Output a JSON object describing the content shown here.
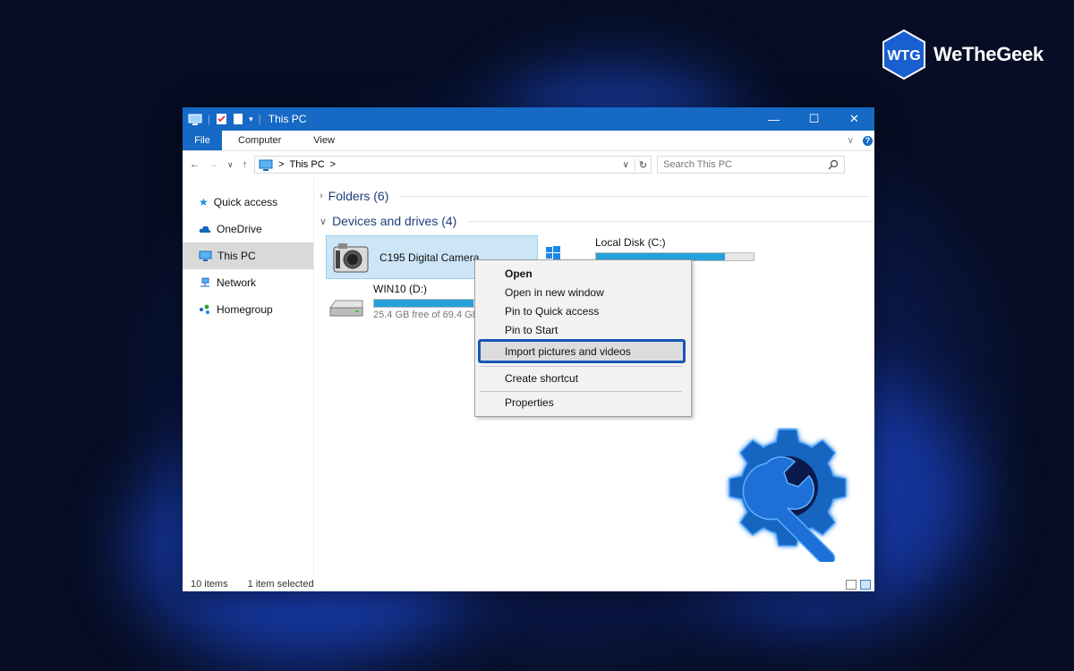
{
  "brand": {
    "logo_text": "WTG",
    "name": "WeTheGeek"
  },
  "window": {
    "title": "This PC",
    "controls": {
      "minimize": "—",
      "maximize": "☐",
      "close": "✕"
    }
  },
  "ribbon": {
    "file": "File",
    "tabs": [
      "Computer",
      "View"
    ],
    "help": "?"
  },
  "address": {
    "path_root": "This PC",
    "separator": ">",
    "search_placeholder": "Search This PC"
  },
  "sidebar": {
    "items": [
      {
        "label": "Quick access",
        "icon": "star-icon"
      },
      {
        "label": "OneDrive",
        "icon": "cloud-icon"
      },
      {
        "label": "This PC",
        "icon": "monitor-icon",
        "selected": true
      },
      {
        "label": "Network",
        "icon": "network-icon"
      },
      {
        "label": "Homegroup",
        "icon": "homegroup-icon"
      }
    ]
  },
  "groups": {
    "folders": "Folders (6)",
    "devices": "Devices and drives (4)"
  },
  "drives": {
    "camera": {
      "name": "C195 Digital Camera"
    },
    "local": {
      "name": "Local Disk (C:)",
      "used_fraction": 0.82
    },
    "win10": {
      "name": "WIN10 (D:)",
      "free_text": "25.4 GB free of 69.4 GB",
      "used_fraction": 0.63
    }
  },
  "context_menu": {
    "open": "Open",
    "open_new_window": "Open in new window",
    "pin_quick": "Pin to Quick access",
    "pin_start": "Pin to Start",
    "import": "Import pictures and videos",
    "create_shortcut": "Create shortcut",
    "properties": "Properties"
  },
  "status": {
    "items": "10 items",
    "selected": "1 item selected"
  },
  "colors": {
    "accent": "#1669c4",
    "highlight": "#1855b6",
    "drive_bar": "#26a0da"
  }
}
